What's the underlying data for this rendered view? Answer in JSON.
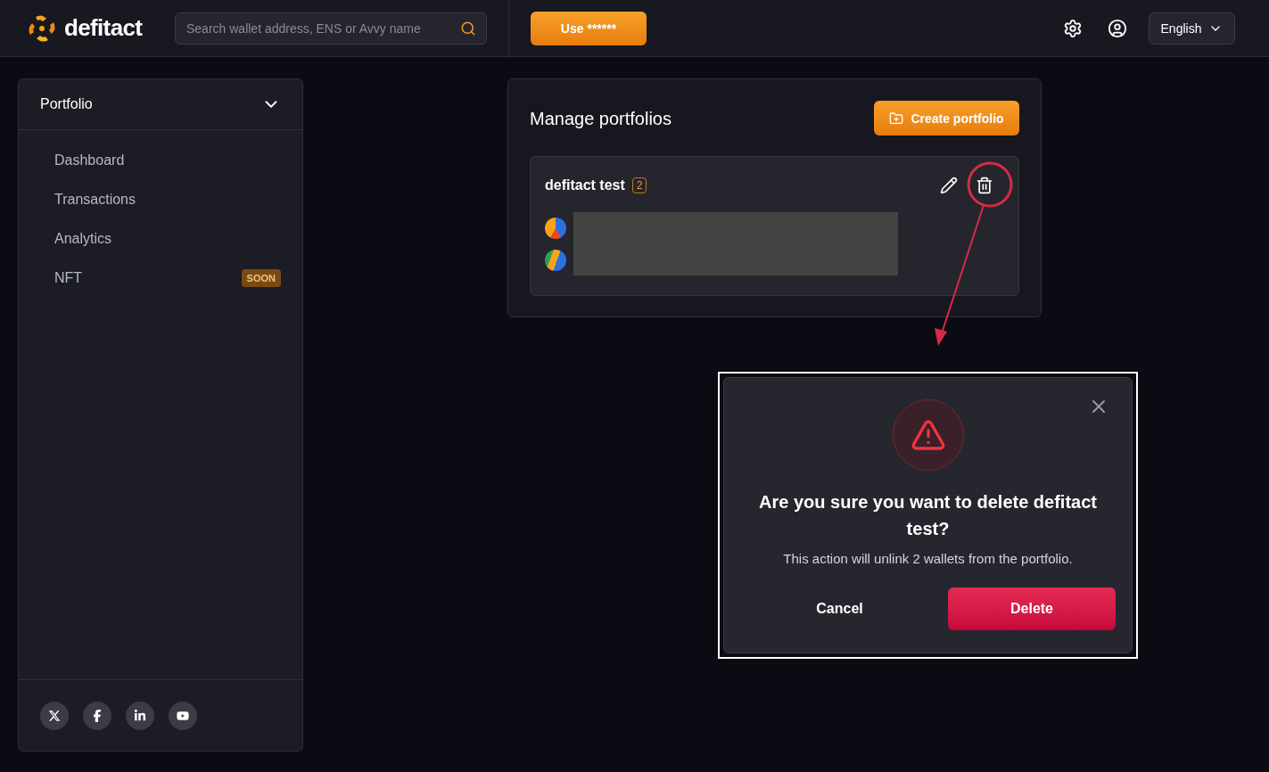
{
  "header": {
    "logo": "defitact",
    "search": {
      "placeholder": "Search wallet address, ENS or Avvy name"
    },
    "promo_button": "Use ******",
    "language": "English"
  },
  "sidebar": {
    "section": {
      "label": "Portfolio",
      "expanded": true
    },
    "items": [
      {
        "label": "Dashboard"
      },
      {
        "label": "Transactions"
      },
      {
        "label": "Analytics"
      },
      {
        "label": "NFT",
        "badge": "SOON"
      }
    ]
  },
  "main": {
    "title": "Manage portfolios",
    "create_button": "Create portfolio",
    "portfolios": [
      {
        "name": "defitact test",
        "count": "2"
      }
    ]
  },
  "dialog": {
    "title": "Are you sure you want to delete defitact test?",
    "message": "This action will unlink 2 wallets from the portfolio.",
    "cancel": "Cancel",
    "confirm": "Delete"
  }
}
